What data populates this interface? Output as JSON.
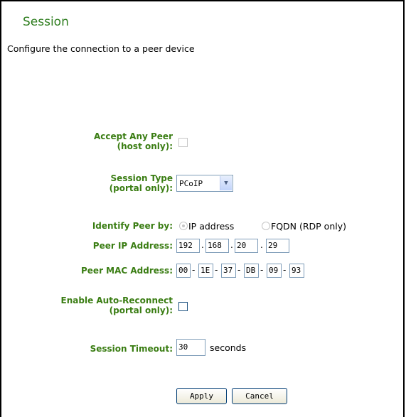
{
  "header": {
    "title": "Session",
    "description": "Configure the connection to a peer device"
  },
  "form": {
    "accept_any_peer": {
      "label_line1": "Accept Any Peer",
      "label_line2": "(host only):",
      "checked": false,
      "enabled": false
    },
    "session_type": {
      "label_line1": "Session Type",
      "label_line2": "(portal only):",
      "value": "PCoIP"
    },
    "identify_peer": {
      "label": "Identify Peer by:",
      "options": [
        "IP address",
        "FQDN (RDP only)"
      ],
      "selected": "IP address"
    },
    "peer_ip": {
      "label": "Peer IP Address:",
      "octets": [
        "192",
        "168",
        "20",
        "29"
      ],
      "separator": "."
    },
    "peer_mac": {
      "label": "Peer MAC Address:",
      "bytes": [
        "00",
        "1E",
        "37",
        "DB",
        "09",
        "93"
      ],
      "separator": "-"
    },
    "auto_reconnect": {
      "label_line1": "Enable Auto-Reconnect",
      "label_line2": "(portal only):",
      "checked": false
    },
    "session_timeout": {
      "label": "Session Timeout:",
      "value": "30",
      "unit": "seconds"
    }
  },
  "buttons": {
    "apply": "Apply",
    "cancel": "Cancel"
  },
  "colors": {
    "label_green": "#3a7d13",
    "title_green": "#2e7d1e"
  }
}
